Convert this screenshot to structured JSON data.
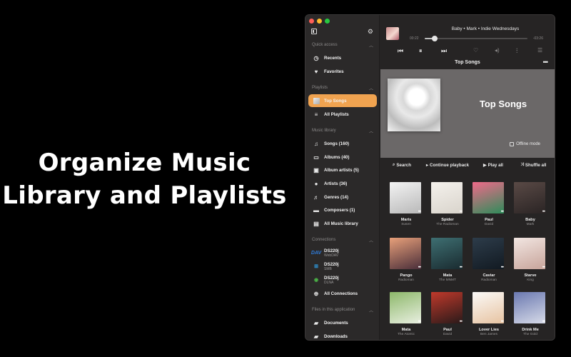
{
  "promo": {
    "line1": "Organize Music",
    "line2": "Library and Playlists"
  },
  "sidebar": {
    "settings_icon": "gear-icon",
    "sections": {
      "quick_access": "Quick access",
      "playlists": "Playlists",
      "music_library": "Music library",
      "connections": "Connections",
      "files": "Files in this application"
    },
    "quick_access": [
      {
        "label": "Recents",
        "icon": "clock-icon"
      },
      {
        "label": "Favorites",
        "icon": "heart-icon"
      }
    ],
    "playlists": [
      {
        "label": "Top Songs",
        "icon": "playlist-cover-icon",
        "active": true
      },
      {
        "label": "All Playlists",
        "icon": "playlists-icon"
      }
    ],
    "library": [
      {
        "label": "Songs (160)",
        "icon": "note-icon"
      },
      {
        "label": "Albums (40)",
        "icon": "album-icon"
      },
      {
        "label": "Album artists (5)",
        "icon": "album-artist-icon"
      },
      {
        "label": "Artists (36)",
        "icon": "person-icon"
      },
      {
        "label": "Genres (14)",
        "icon": "genre-icon"
      },
      {
        "label": "Composers (1)",
        "icon": "composer-icon"
      },
      {
        "label": "All Music library",
        "icon": "library-icon"
      }
    ],
    "connections": [
      {
        "name": "DS220j",
        "proto": "WebDAV",
        "icon": "webdav-icon"
      },
      {
        "name": "DS220j",
        "proto": "SMB",
        "icon": "windows-icon"
      },
      {
        "name": "DS220j",
        "proto": "DLNA",
        "icon": "dlna-icon"
      }
    ],
    "all_connections": "All Connections",
    "files": [
      {
        "label": "Documents",
        "icon": "folder-documents-icon"
      },
      {
        "label": "Downloads",
        "icon": "folder-downloads-icon"
      }
    ]
  },
  "player": {
    "now_playing": "Baby • Mark • Indie Wednesdays",
    "elapsed": "00:22",
    "remaining": "-03:26",
    "progress": 0.1
  },
  "page": {
    "title": "Top Songs",
    "hero_title": "Top Songs",
    "offline_mode": "Offline mode"
  },
  "actions": {
    "search": "Search",
    "continue": "Continue playback",
    "play_all": "Play all",
    "shuffle_all": "Shuffle all"
  },
  "songs": [
    {
      "title": "Maris",
      "artist": "Susen",
      "colors": [
        "#f3f3f3",
        "#b9b9b9"
      ]
    },
    {
      "title": "Spider",
      "artist": "The Radioman",
      "colors": [
        "#f4f1ec",
        "#d9d4cc"
      ]
    },
    {
      "title": "Paul",
      "artist": "David",
      "colors": [
        "#f06a8a",
        "#2e8c5a"
      ]
    },
    {
      "title": "Baby",
      "artist": "Mark",
      "colors": [
        "#5a4a46",
        "#2a2424"
      ]
    },
    {
      "title": "Pango",
      "artist": "Radioman",
      "colors": [
        "#e8a07a",
        "#4a2e3a"
      ]
    },
    {
      "title": "Mata",
      "artist": "The MNMT",
      "colors": [
        "#3e6f72",
        "#1a2b30"
      ]
    },
    {
      "title": "Caviar",
      "artist": "Radioman",
      "colors": [
        "#2d3c4a",
        "#121a22"
      ]
    },
    {
      "title": "Starve",
      "artist": "King",
      "colors": [
        "#f2e6e2",
        "#c7a49a"
      ]
    },
    {
      "title": "Mata",
      "artist": "The Atomic",
      "colors": [
        "#8db86a",
        "#e9efe1"
      ]
    },
    {
      "title": "Paul",
      "artist": "David",
      "colors": [
        "#c0392b",
        "#2a1a1a"
      ]
    },
    {
      "title": "Lover Lies",
      "artist": "Ben James",
      "colors": [
        "#fbfaf8",
        "#e7c3a1"
      ]
    },
    {
      "title": "Drink Me",
      "artist": "The Gold",
      "colors": [
        "#6a78b0",
        "#d7dbe8"
      ]
    }
  ]
}
